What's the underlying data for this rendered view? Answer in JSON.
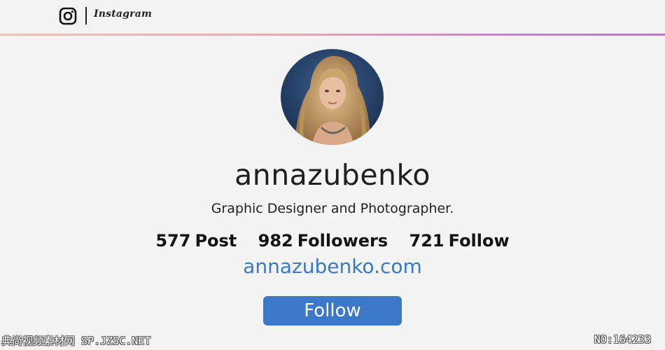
{
  "header": {
    "icon": "instagram-icon",
    "wordmark": "Instagram",
    "accent_gradient": [
      "#f3c2b8",
      "#e7a6b0",
      "#c785c3",
      "#b07ccb"
    ]
  },
  "profile": {
    "avatar_icon": "profile-photo",
    "username": "annazubenko",
    "bio": "Graphic Designer and Photographer.",
    "stats": [
      {
        "value": "577",
        "label": "Post"
      },
      {
        "value": "982",
        "label": "Followers"
      },
      {
        "value": "721",
        "label": "Follow"
      }
    ],
    "website": "annazubenko.com",
    "follow_label": "Follow",
    "follow_color": "#3b78c8",
    "link_color": "#3a79c5"
  },
  "watermark": {
    "left": "典尚视频素材网 SP.JZSC.NET",
    "right": "NO:164233"
  }
}
